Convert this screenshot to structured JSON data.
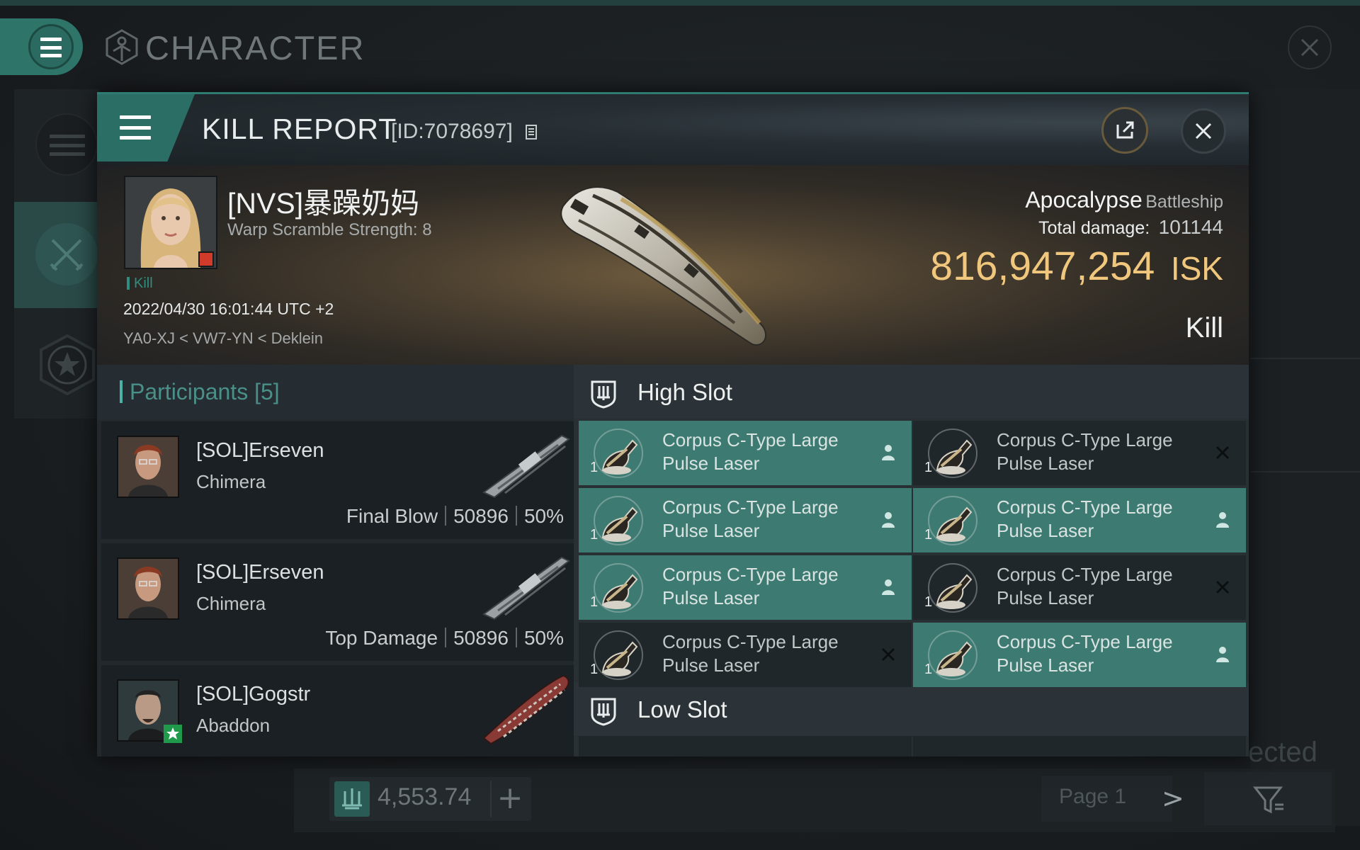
{
  "background_window": {
    "title": "CHARACTER",
    "wallet_value": "4,553.74",
    "add_label": "+",
    "page_label": "Page 1",
    "next_label": ">",
    "corner_fragment": "ected"
  },
  "kill_report": {
    "title": "KILL REPORT",
    "id": "[ID:7078697]",
    "victim": {
      "name": "[NVS]暴躁奶妈",
      "warp_scramble": "Warp Scramble Strength: 8",
      "tag": "Kill",
      "datetime": "2022/04/30 16:01:44 UTC +2",
      "location": "YA0-XJ < VW7-YN < Deklein"
    },
    "ship": {
      "name": "Apocalypse",
      "class": "Battleship",
      "damage_label": "Total damage:",
      "damage_value": "101144",
      "isk_value": "816,947,254",
      "isk_unit": "ISK",
      "result": "Kill"
    },
    "participants": {
      "title": "Participants [5]",
      "rows": [
        {
          "name": "[SOL]Erseven",
          "ship": "Chimera",
          "role": "Final Blow",
          "damage": "50896",
          "percent": "50%"
        },
        {
          "name": "[SOL]Erseven",
          "ship": "Chimera",
          "role": "Top Damage",
          "damage": "50896",
          "percent": "50%"
        },
        {
          "name": "[SOL]Gogstr",
          "ship": "Abaddon",
          "role": "",
          "damage": "",
          "percent": ""
        }
      ]
    },
    "high_slot": {
      "title": "High Slot",
      "modules": [
        {
          "name": "Corpus C-Type Large Pulse Laser",
          "qty": "1",
          "status": "fitted"
        },
        {
          "name": "Corpus C-Type Large Pulse Laser",
          "qty": "1",
          "status": "destroyed"
        },
        {
          "name": "Corpus C-Type Large Pulse Laser",
          "qty": "1",
          "status": "fitted"
        },
        {
          "name": "Corpus C-Type Large Pulse Laser",
          "qty": "1",
          "status": "fitted"
        },
        {
          "name": "Corpus C-Type Large Pulse Laser",
          "qty": "1",
          "status": "fitted"
        },
        {
          "name": "Corpus C-Type Large Pulse Laser",
          "qty": "1",
          "status": "destroyed"
        },
        {
          "name": "Corpus C-Type Large Pulse Laser",
          "qty": "1",
          "status": "destroyed"
        },
        {
          "name": "Corpus C-Type Large Pulse Laser",
          "qty": "1",
          "status": "fitted"
        }
      ]
    },
    "low_slot": {
      "title": "Low Slot"
    }
  },
  "colors": {
    "accent": "#2f7468",
    "fitted_slot": "#3d7b72",
    "isk": "#f1c77e",
    "victim_badge": "#d23a2a"
  },
  "icons": [
    "menu-icon",
    "character-icon",
    "close-icon",
    "share-icon",
    "copy-icon",
    "slot-icon",
    "pilot-icon",
    "destroyed-icon",
    "filter-icon",
    "wallet-icon",
    "star-icon"
  ]
}
